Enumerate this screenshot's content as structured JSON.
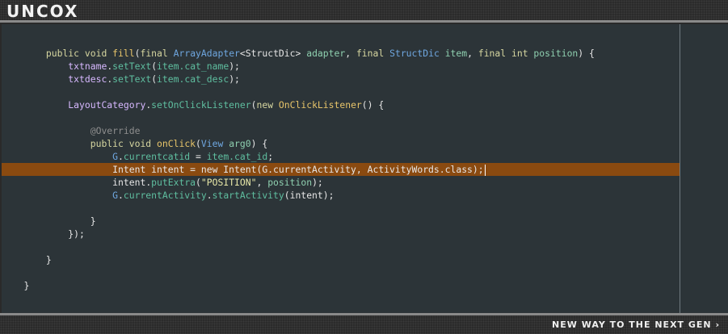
{
  "header": {
    "logo": "UNCOX"
  },
  "footer": {
    "tagline": "NEW WAY TO THE NEXT GEN ›"
  },
  "code": {
    "l1": {
      "indent": "        ",
      "kw1": "public void ",
      "fn": "fill",
      "open": "(",
      "kw2": "final ",
      "type1": "ArrayAdapter",
      "gen": "<StructDic> ",
      "p1": "adapter",
      "c1": ", ",
      "kw3": "final ",
      "type2": "StructDic ",
      "p2": "item",
      "c2": ", ",
      "kw4": "final int ",
      "p3": "position",
      "close": ") {"
    },
    "l2": {
      "indent": "            ",
      "obj": "txtname",
      "dot": ".",
      "m": "setText",
      "o": "(",
      "f": "item.cat_name",
      "e": ");"
    },
    "l3": {
      "indent": "            ",
      "obj": "txtdesc",
      "dot": ".",
      "m": "setText",
      "o": "(",
      "f": "item.cat_desc",
      "e": ");"
    },
    "l4": {
      "indent": "            ",
      "obj": "LayoutCategory",
      "dot": ".",
      "m": "setOnClickListener",
      "o": "(",
      "kw": "new ",
      "cls": "OnClickListener",
      "e": "() {"
    },
    "l5": {
      "indent": "                ",
      "ann": "@Override"
    },
    "l6": {
      "indent": "                ",
      "kw": "public void ",
      "fn": "onClick",
      "o": "(",
      "t": "View ",
      "p": "arg0",
      "e": ") {"
    },
    "l7": {
      "indent": "                    ",
      "g": "G",
      "dot": ".",
      "fld": "currentcatid",
      "eq": " = ",
      "rhs": "item.cat_id",
      "e": ";"
    },
    "l8": {
      "indent": "                    ",
      "text": "Intent intent = new Intent(G.currentActivity, ActivityWords.class);"
    },
    "l9": {
      "indent": "                    ",
      "obj": "intent",
      "dot": ".",
      "m": "putExtra",
      "o": "(",
      "str": "\"POSITION\"",
      "c": ", ",
      "p": "position",
      "e": ");"
    },
    "l10": {
      "indent": "                    ",
      "g": "G",
      "dot": ".",
      "fld": "currentActivity",
      "dot2": ".",
      "m": "startActivity",
      "e": "(intent);"
    },
    "l11": {
      "indent": "                ",
      "text": "}"
    },
    "l12": {
      "indent": "            ",
      "text": "});"
    },
    "l13": {
      "indent": "        ",
      "text": "}"
    },
    "l14": {
      "indent": "    ",
      "text": "}"
    }
  }
}
